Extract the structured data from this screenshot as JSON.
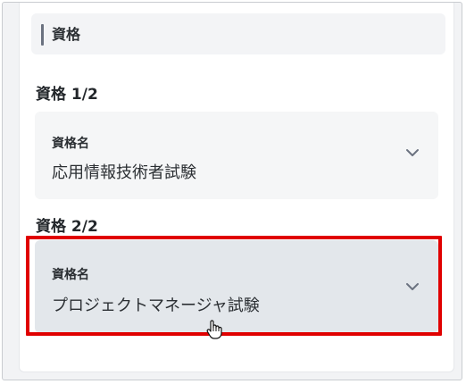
{
  "section": {
    "title": "資格"
  },
  "qualifications": [
    {
      "heading": "資格 1/2",
      "field_label": "資格名",
      "value": "応用情報技術者試験"
    },
    {
      "heading": "資格 2/2",
      "field_label": "資格名",
      "value": "プロジェクトマネージャ試験"
    }
  ],
  "colors": {
    "highlight": "#e00000",
    "selected_bg": "#e3e7eb",
    "field_bg": "#f5f6f7"
  },
  "icons": [
    "chevron-down-icon",
    "hand-cursor-icon"
  ]
}
